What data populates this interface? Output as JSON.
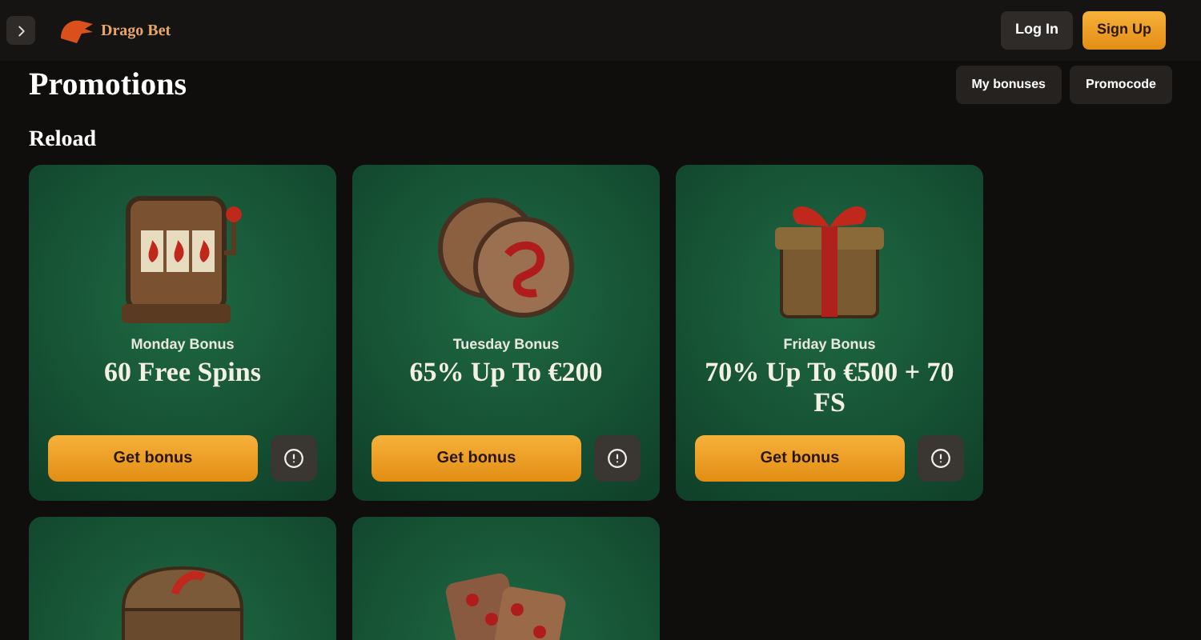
{
  "header": {
    "brand": "Drago Bet",
    "login": "Log In",
    "signup": "Sign Up"
  },
  "page": {
    "title": "Promotions",
    "actions": [
      "My bonuses",
      "Promocode"
    ]
  },
  "section": {
    "title": "Reload"
  },
  "cards": [
    {
      "kind": "slot",
      "subtitle": "Monday Bonus",
      "title": "60 Free Spins",
      "button": "Get bonus"
    },
    {
      "kind": "coins",
      "subtitle": "Tuesday Bonus",
      "title": "65% Up To €200",
      "button": "Get bonus"
    },
    {
      "kind": "gift",
      "subtitle": "Friday Bonus",
      "title": "70% Up To €500 + 70 FS",
      "button": "Get bonus"
    },
    {
      "kind": "chest"
    },
    {
      "kind": "dice"
    }
  ]
}
